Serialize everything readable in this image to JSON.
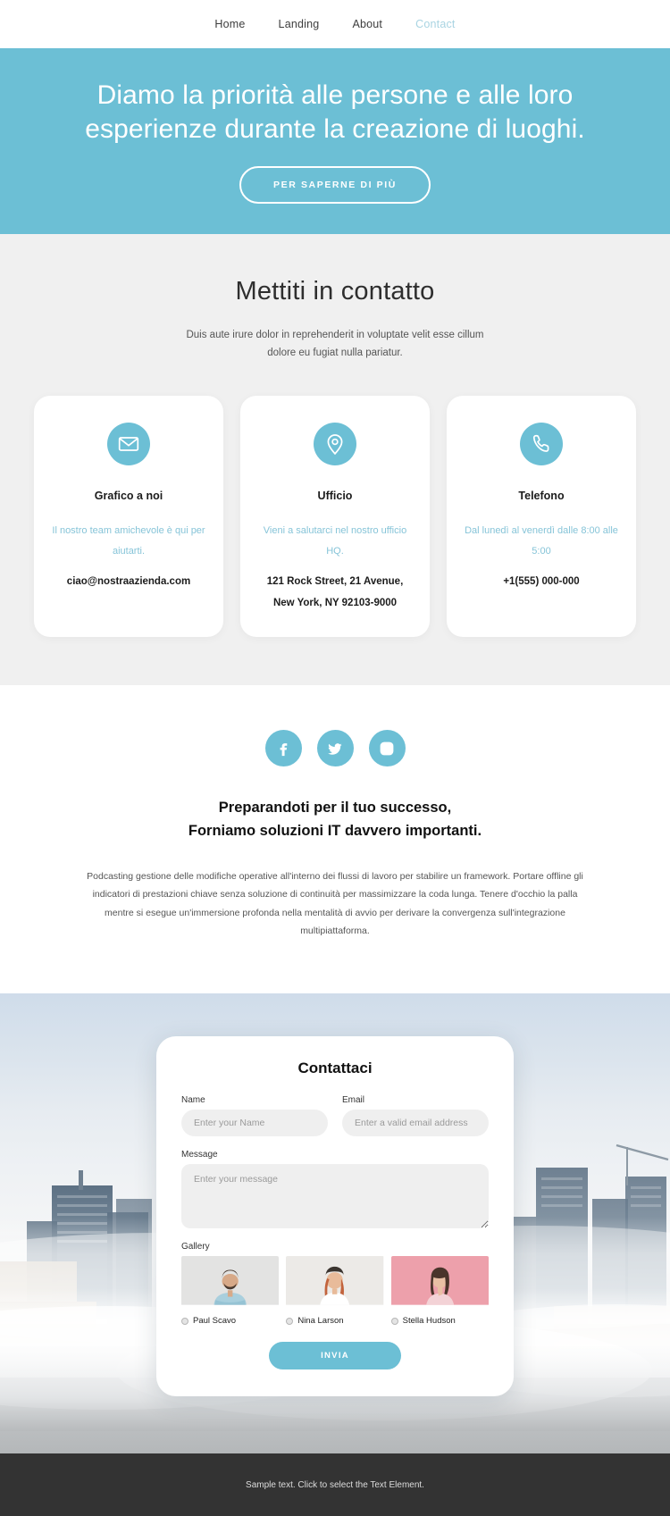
{
  "nav": {
    "items": [
      {
        "label": "Home",
        "active": false
      },
      {
        "label": "Landing",
        "active": false
      },
      {
        "label": "About",
        "active": false
      },
      {
        "label": "Contact",
        "active": true
      }
    ]
  },
  "hero": {
    "title": "Diamo la priorità alle persone e alle loro esperienze durante la creazione di luoghi.",
    "button": "PER SAPERNE DI PIÙ",
    "bg_color": "#6cbfd5"
  },
  "contact": {
    "title": "Mettiti in contatto",
    "subtitle": "Duis aute irure dolor in reprehenderit in voluptate velit esse cillum dolore eu fugiat nulla pariatur.",
    "cards": [
      {
        "icon": "envelope-icon",
        "title": "Grafico a noi",
        "description": "Il nostro team amichevole è qui per aiutarti.",
        "value": "ciao@nostraazienda.com"
      },
      {
        "icon": "location-pin-icon",
        "title": "Ufficio",
        "description": "Vieni a salutarci nel nostro ufficio HQ.",
        "value": "121 Rock Street, 21 Avenue, New York, NY 92103-9000"
      },
      {
        "icon": "phone-icon",
        "title": "Telefono",
        "description": "Dal lunedì al venerdì dalle 8:00 alle 5:00",
        "value": "+1(555) 000-000"
      }
    ]
  },
  "social": {
    "icons": [
      {
        "name": "facebook-icon"
      },
      {
        "name": "twitter-icon"
      },
      {
        "name": "instagram-icon"
      }
    ],
    "pitch_line1": "Preparandoti per il tuo successo,",
    "pitch_line2": "Forniamo soluzioni IT davvero importanti.",
    "body": "Podcasting gestione delle modifiche operative all'interno dei flussi di lavoro per stabilire un framework. Portare offline gli indicatori di prestazioni chiave senza soluzione di continuità per massimizzare la coda lunga. Tenere d'occhio la palla mentre si esegue un'immersione profonda nella mentalità di avvio per derivare la convergenza sull'integrazione multipiattaforma."
  },
  "form": {
    "title": "Contattaci",
    "name_label": "Name",
    "name_placeholder": "Enter your Name",
    "email_label": "Email",
    "email_placeholder": "Enter a valid email address",
    "message_label": "Message",
    "message_placeholder": "Enter your message",
    "gallery_label": "Gallery",
    "gallery": [
      {
        "name": "Paul Scavo"
      },
      {
        "name": "Nina Larson"
      },
      {
        "name": "Stella Hudson"
      }
    ],
    "submit_label": "INVIA"
  },
  "footer": {
    "text": "Sample text. Click to select the Text Element.",
    "bg_color": "#333333"
  }
}
